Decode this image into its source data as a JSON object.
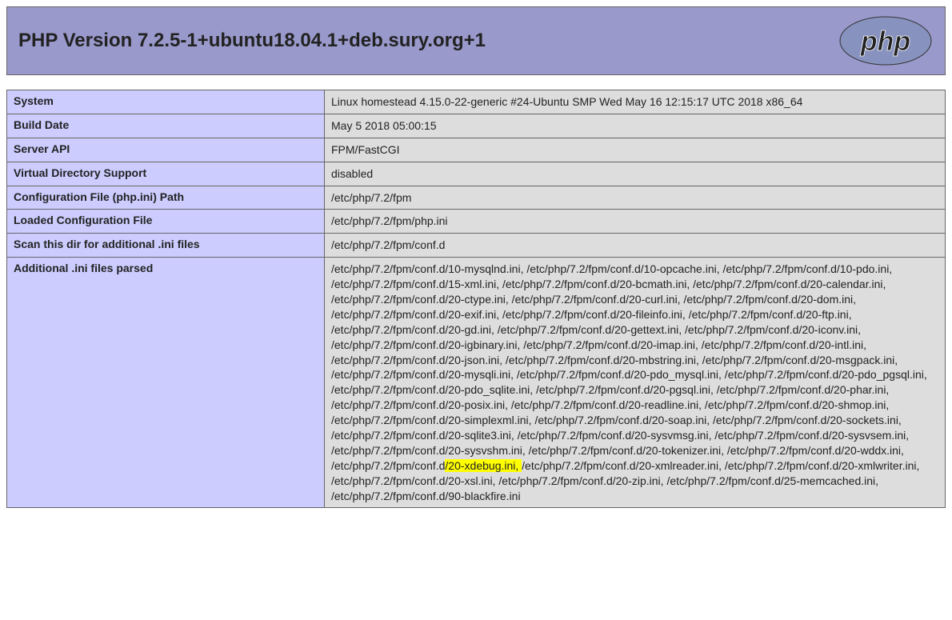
{
  "header": {
    "title": "PHP Version 7.2.5-1+ubuntu18.04.1+deb.sury.org+1",
    "logo_alt": "php-logo"
  },
  "rows": [
    {
      "label": "System",
      "value": "Linux homestead 4.15.0-22-generic #24-Ubuntu SMP Wed May 16 12:15:17 UTC 2018 x86_64"
    },
    {
      "label": "Build Date",
      "value": "May 5 2018 05:00:15"
    },
    {
      "label": "Server API",
      "value": "FPM/FastCGI"
    },
    {
      "label": "Virtual Directory Support",
      "value": "disabled"
    },
    {
      "label": "Configuration File (php.ini) Path",
      "value": "/etc/php/7.2/fpm"
    },
    {
      "label": "Loaded Configuration File",
      "value": "/etc/php/7.2/fpm/php.ini"
    },
    {
      "label": "Scan this dir for additional .ini files",
      "value": "/etc/php/7.2/fpm/conf.d"
    }
  ],
  "additional": {
    "label": "Additional .ini files parsed",
    "before": "/etc/php/7.2/fpm/conf.d/10-mysqlnd.ini, /etc/php/7.2/fpm/conf.d/10-opcache.ini, /etc/php/7.2/fpm/conf.d/10-pdo.ini, /etc/php/7.2/fpm/conf.d/15-xml.ini, /etc/php/7.2/fpm/conf.d/20-bcmath.ini, /etc/php/7.2/fpm/conf.d/20-calendar.ini, /etc/php/7.2/fpm/conf.d/20-ctype.ini, /etc/php/7.2/fpm/conf.d/20-curl.ini, /etc/php/7.2/fpm/conf.d/20-dom.ini, /etc/php/7.2/fpm/conf.d/20-exif.ini, /etc/php/7.2/fpm/conf.d/20-fileinfo.ini, /etc/php/7.2/fpm/conf.d/20-ftp.ini, /etc/php/7.2/fpm/conf.d/20-gd.ini, /etc/php/7.2/fpm/conf.d/20-gettext.ini, /etc/php/7.2/fpm/conf.d/20-iconv.ini, /etc/php/7.2/fpm/conf.d/20-igbinary.ini, /etc/php/7.2/fpm/conf.d/20-imap.ini, /etc/php/7.2/fpm/conf.d/20-intl.ini, /etc/php/7.2/fpm/conf.d/20-json.ini, /etc/php/7.2/fpm/conf.d/20-mbstring.ini, /etc/php/7.2/fpm/conf.d/20-msgpack.ini, /etc/php/7.2/fpm/conf.d/20-mysqli.ini, /etc/php/7.2/fpm/conf.d/20-pdo_mysql.ini, /etc/php/7.2/fpm/conf.d/20-pdo_pgsql.ini, /etc/php/7.2/fpm/conf.d/20-pdo_sqlite.ini, /etc/php/7.2/fpm/conf.d/20-pgsql.ini, /etc/php/7.2/fpm/conf.d/20-phar.ini, /etc/php/7.2/fpm/conf.d/20-posix.ini, /etc/php/7.2/fpm/conf.d/20-readline.ini, /etc/php/7.2/fpm/conf.d/20-shmop.ini, /etc/php/7.2/fpm/conf.d/20-simplexml.ini, /etc/php/7.2/fpm/conf.d/20-soap.ini, /etc/php/7.2/fpm/conf.d/20-sockets.ini, /etc/php/7.2/fpm/conf.d/20-sqlite3.ini, /etc/php/7.2/fpm/conf.d/20-sysvmsg.ini, /etc/php/7.2/fpm/conf.d/20-sysvsem.ini, /etc/php/7.2/fpm/conf.d/20-sysvshm.ini, /etc/php/7.2/fpm/conf.d/20-tokenizer.ini, /etc/php/7.2/fpm/conf.d/20-wddx.ini, /etc/php/7.2/fpm/conf.d",
    "highlight": "/20-xdebug.ini, ",
    "after": "/etc/php/7.2/fpm/conf.d/20-xmlreader.ini, /etc/php/7.2/fpm/conf.d/20-xmlwriter.ini, /etc/php/7.2/fpm/conf.d/20-xsl.ini, /etc/php/7.2/fpm/conf.d/20-zip.ini, /etc/php/7.2/fpm/conf.d/25-memcached.ini, /etc/php/7.2/fpm/conf.d/90-blackfire.ini"
  }
}
